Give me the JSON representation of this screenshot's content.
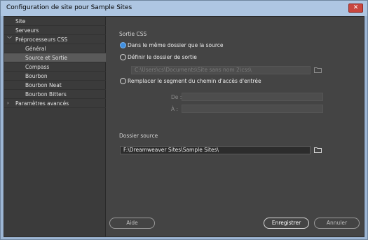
{
  "window": {
    "title": "Configuration de site pour Sample Sites",
    "close_glyph": "✕"
  },
  "sidebar": {
    "items": [
      {
        "label": "Site"
      },
      {
        "label": "Serveurs"
      },
      {
        "label": "Préprocesseurs CSS",
        "chevron": "﹀"
      },
      {
        "label": "Général"
      },
      {
        "label": "Source et Sortie"
      },
      {
        "label": "Compass"
      },
      {
        "label": "Bourbon"
      },
      {
        "label": "Bourbon Neat"
      },
      {
        "label": "Bourbon Bitters"
      },
      {
        "label": "Paramètres avancés",
        "chevron": "›"
      }
    ],
    "selected_index": 4
  },
  "main": {
    "output_section_label": "Sortie CSS",
    "options": [
      {
        "label": "Dans le même dossier que la source",
        "checked": true
      },
      {
        "label": "Définir le dossier de sortie",
        "checked": false
      },
      {
        "label": "Remplacer le segment du chemin d'accès d'entrée",
        "checked": false
      }
    ],
    "output_folder_value": "C:\\Users\\cs\\Documents\\Site sans nom 2\\css\\",
    "replace_from_label": "De :",
    "replace_to_label": "À :",
    "source_section_label": "Dossier source",
    "source_folder_value": "F:\\Dreamweaver Sites\\Sample Sites\\"
  },
  "footer": {
    "help_label": "Aide",
    "save_label": "Enregistrer",
    "cancel_label": "Annuler"
  },
  "icons": {
    "folder": "folder-icon",
    "close": "close-icon",
    "chevron": "chevron-icon"
  },
  "colors": {
    "radio_checked": "#3f8fe0",
    "titlebar": "#aec6e2",
    "panel": "#444444"
  }
}
